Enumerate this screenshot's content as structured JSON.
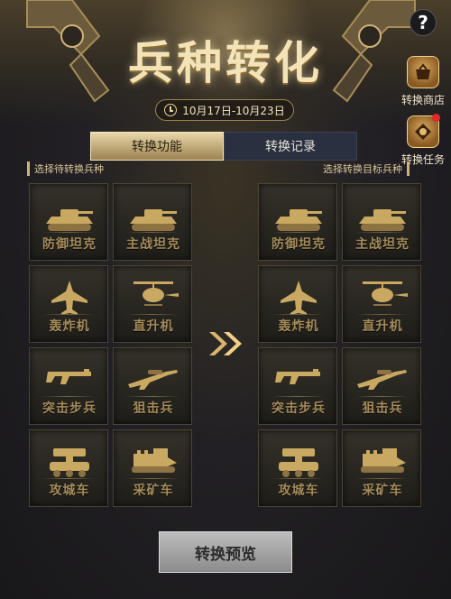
{
  "header": {
    "title": "兵种转化",
    "date_range": "10月17日-10月23日",
    "help_label": "?"
  },
  "side_menu": [
    {
      "label": "转换商店",
      "icon": "shop-icon",
      "badge": false
    },
    {
      "label": "转换任务",
      "icon": "task-icon",
      "badge": true
    }
  ],
  "tabs": [
    {
      "label": "转换功能",
      "active": true
    },
    {
      "label": "转换记录",
      "active": false
    }
  ],
  "left_panel": {
    "label": "选择待转换兵种",
    "units": [
      {
        "label": "防御坦克",
        "icon": "tank-icon"
      },
      {
        "label": "主战坦克",
        "icon": "tank-icon"
      },
      {
        "label": "轰炸机",
        "icon": "bomber-icon"
      },
      {
        "label": "直升机",
        "icon": "helicopter-icon"
      },
      {
        "label": "突击步兵",
        "icon": "rifle-icon"
      },
      {
        "label": "狙击兵",
        "icon": "sniper-rifle-icon"
      },
      {
        "label": "攻城车",
        "icon": "siege-vehicle-icon"
      },
      {
        "label": "采矿车",
        "icon": "mining-vehicle-icon"
      }
    ]
  },
  "right_panel": {
    "label": "选择转换目标兵种",
    "units": [
      {
        "label": "防御坦克",
        "icon": "tank-icon"
      },
      {
        "label": "主战坦克",
        "icon": "tank-icon"
      },
      {
        "label": "轰炸机",
        "icon": "bomber-icon"
      },
      {
        "label": "直升机",
        "icon": "helicopter-icon"
      },
      {
        "label": "突击步兵",
        "icon": "rifle-icon"
      },
      {
        "label": "狙击兵",
        "icon": "sniper-rifle-icon"
      },
      {
        "label": "攻城车",
        "icon": "siege-vehicle-icon"
      },
      {
        "label": "采矿车",
        "icon": "mining-vehicle-icon"
      }
    ]
  },
  "actions": {
    "preview_label": "转换预览"
  },
  "colors": {
    "gold": "#b8975a",
    "active_tab": "#e8d7a8",
    "inactive_tab": "#2a3040"
  }
}
